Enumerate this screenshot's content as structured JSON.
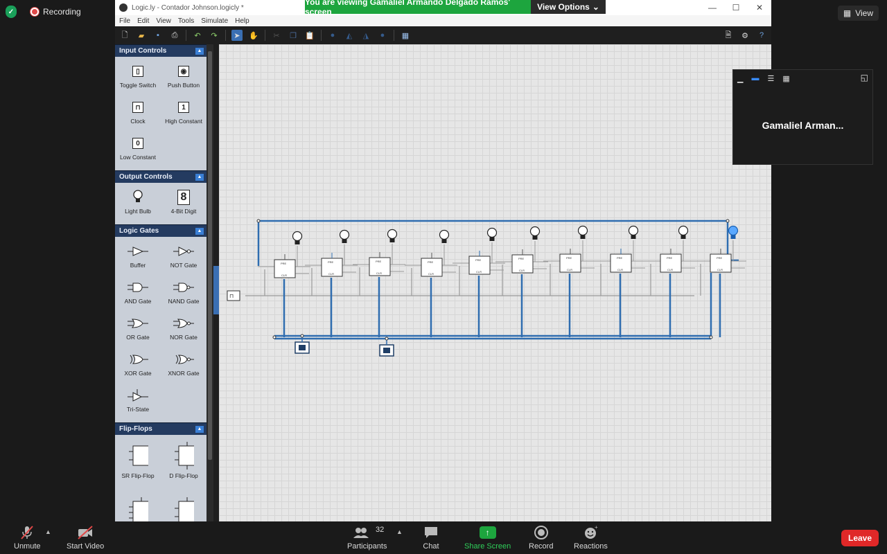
{
  "zoom": {
    "recording_label": "Recording",
    "view_label": "View",
    "share_banner": "You are viewing Gamaliel Armando Delgado Ramos' screen",
    "view_options": "View Options",
    "participant_tile_name": "Gamaliel Arman...",
    "participants_count": "32",
    "bottom": {
      "unmute": "Unmute",
      "start_video": "Start Video",
      "participants": "Participants",
      "chat": "Chat",
      "share_screen": "Share Screen",
      "record": "Record",
      "reactions": "Reactions",
      "leave": "Leave"
    },
    "colors": {
      "green": "#1da53e",
      "leave_red": "#e02828"
    }
  },
  "app": {
    "title": "Logic.ly - Contador Johnson.logicly *",
    "menu": [
      "File",
      "Edit",
      "View",
      "Tools",
      "Simulate",
      "Help"
    ],
    "sections": {
      "input_controls": {
        "title": "Input Controls",
        "items": [
          {
            "label": "Toggle Switch",
            "icon": "toggle-switch-icon",
            "glyph": "▣"
          },
          {
            "label": "Push Button",
            "icon": "push-button-icon",
            "glyph": "◉"
          },
          {
            "label": "Clock",
            "icon": "clock-icon",
            "glyph": "⊓"
          },
          {
            "label": "High Constant",
            "icon": "high-constant-icon",
            "glyph": "1"
          },
          {
            "label": "Low Constant",
            "icon": "low-constant-icon",
            "glyph": "0"
          }
        ]
      },
      "output_controls": {
        "title": "Output Controls",
        "items": [
          {
            "label": "Light Bulb",
            "icon": "light-bulb-icon",
            "glyph": "💡"
          },
          {
            "label": "4-Bit Digit",
            "icon": "four-bit-digit-icon",
            "glyph": "8"
          }
        ]
      },
      "logic_gates": {
        "title": "Logic Gates",
        "items": [
          {
            "label": "Buffer",
            "icon": "buffer-gate-icon",
            "glyph": "▷"
          },
          {
            "label": "NOT Gate",
            "icon": "not-gate-icon",
            "glyph": "▷o"
          },
          {
            "label": "AND Gate",
            "icon": "and-gate-icon",
            "glyph": "D"
          },
          {
            "label": "NAND Gate",
            "icon": "nand-gate-icon",
            "glyph": "Do"
          },
          {
            "label": "OR Gate",
            "icon": "or-gate-icon",
            "glyph": ")"
          },
          {
            "label": "NOR Gate",
            "icon": "nor-gate-icon",
            "glyph": ")o"
          },
          {
            "label": "XOR Gate",
            "icon": "xor-gate-icon",
            "glyph": "))"
          },
          {
            "label": "XNOR Gate",
            "icon": "xnor-gate-icon",
            "glyph": "))o"
          },
          {
            "label": "Tri-State",
            "icon": "tri-state-icon",
            "glyph": "▷"
          }
        ]
      },
      "flip_flops": {
        "title": "Flip-Flops",
        "items": [
          {
            "label": "SR Flip-Flop",
            "icon": "sr-flip-flop-icon",
            "glyph": "▭"
          },
          {
            "label": "D Flip-Flop",
            "icon": "d-flip-flop-icon",
            "glyph": "▭"
          },
          {
            "label": "",
            "icon": "jk-flip-flop-icon",
            "glyph": "▭"
          },
          {
            "label": "",
            "icon": "t-flip-flop-icon",
            "glyph": "▭"
          }
        ]
      }
    },
    "flipflop_labels": {
      "pre": "PRE",
      "clr": "CLR"
    },
    "circuit": {
      "flip_flop_count": 10,
      "bulb_count": 10,
      "lit_bulbs": [
        9
      ]
    }
  }
}
